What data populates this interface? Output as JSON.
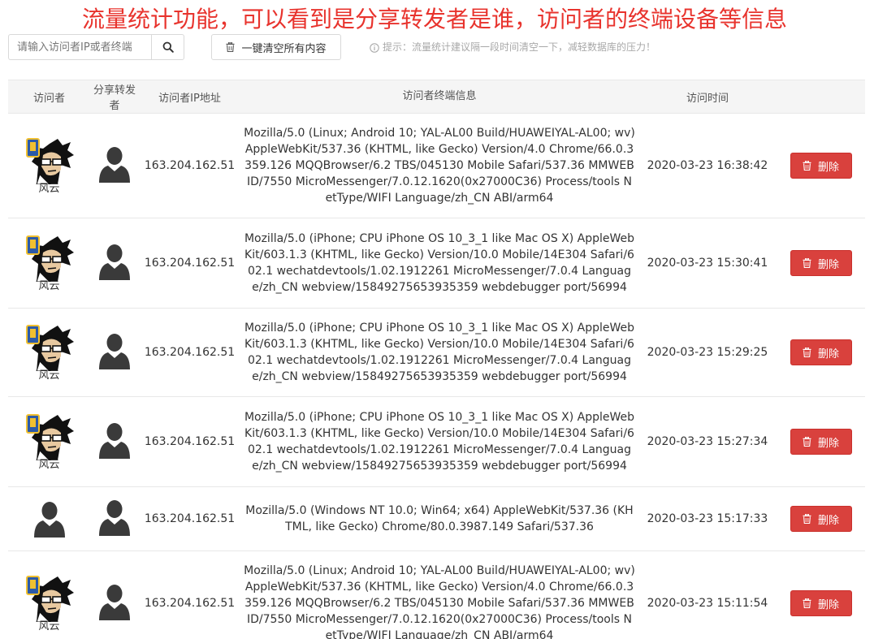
{
  "banner": "流量统计功能，可以看到是分享转发者是谁，访问者的终端设备等信息",
  "toolbar": {
    "search_placeholder": "请输入访问者IP或者终端",
    "clear_label": "一键清空所有内容",
    "tip": "提示：流量统计建议隔一段时间清空一下，减轻数据库的压力！"
  },
  "table": {
    "headers": [
      "访问者",
      "分享转发者",
      "访问者IP地址",
      "访问者终端信息",
      "访问时间"
    ],
    "delete_label": "删除",
    "rows": [
      {
        "visitor_name": "风云",
        "ip": "163.204.162.51",
        "ua": "Mozilla/5.0 (Linux; Android 10; YAL-AL00 Build/HUAWEIYAL-AL00; wv) AppleWebKit/537.36 (KHTML, like Gecko) Version/4.0 Chrome/66.0.3359.126 MQQBrowser/6.2 TBS/045130 Mobile Safari/537.36 MMWEBID/7550 MicroMessenger/7.0.12.1620(0x27000C36) Process/tools NetType/WIFI Language/zh_CN ABI/arm64",
        "time": "2020-03-23 16:38:42"
      },
      {
        "visitor_name": "风云",
        "ip": "163.204.162.51",
        "ua": "Mozilla/5.0 (iPhone; CPU iPhone OS 10_3_1 like Mac OS X) AppleWebKit/603.1.3 (KHTML, like Gecko) Version/10.0 Mobile/14E304 Safari/602.1 wechatdevtools/1.02.1912261 MicroMessenger/7.0.4 Language/zh_CN webview/15849275653935359 webdebugger port/56994",
        "time": "2020-03-23 15:30:41"
      },
      {
        "visitor_name": "风云",
        "ip": "163.204.162.51",
        "ua": "Mozilla/5.0 (iPhone; CPU iPhone OS 10_3_1 like Mac OS X) AppleWebKit/603.1.3 (KHTML, like Gecko) Version/10.0 Mobile/14E304 Safari/602.1 wechatdevtools/1.02.1912261 MicroMessenger/7.0.4 Language/zh_CN webview/15849275653935359 webdebugger port/56994",
        "time": "2020-03-23 15:29:25"
      },
      {
        "visitor_name": "风云",
        "ip": "163.204.162.51",
        "ua": "Mozilla/5.0 (iPhone; CPU iPhone OS 10_3_1 like Mac OS X) AppleWebKit/603.1.3 (KHTML, like Gecko) Version/10.0 Mobile/14E304 Safari/602.1 wechatdevtools/1.02.1912261 MicroMessenger/7.0.4 Language/zh_CN webview/15849275653935359 webdebugger port/56994",
        "time": "2020-03-23 15:27:34"
      },
      {
        "visitor_name": "",
        "ip": "163.204.162.51",
        "ua": "Mozilla/5.0 (Windows NT 10.0; Win64; x64) AppleWebKit/537.36 (KHTML, like Gecko) Chrome/80.0.3987.149 Safari/537.36",
        "time": "2020-03-23 15:17:33"
      },
      {
        "visitor_name": "风云",
        "ip": "163.204.162.51",
        "ua": "Mozilla/5.0 (Linux; Android 10; YAL-AL00 Build/HUAWEIYAL-AL00; wv) AppleWebKit/537.36 (KHTML, like Gecko) Version/4.0 Chrome/66.0.3359.126 MQQBrowser/6.2 TBS/045130 Mobile Safari/537.36 MMWEBID/7550 MicroMessenger/7.0.12.1620(0x27000C36) Process/tools NetType/WIFI Language/zh_CN ABI/arm64",
        "time": "2020-03-23 15:11:54"
      }
    ]
  },
  "colors": {
    "banner": "#e8332d",
    "danger": "#d9413d",
    "header_bg": "#f5f5f5"
  }
}
